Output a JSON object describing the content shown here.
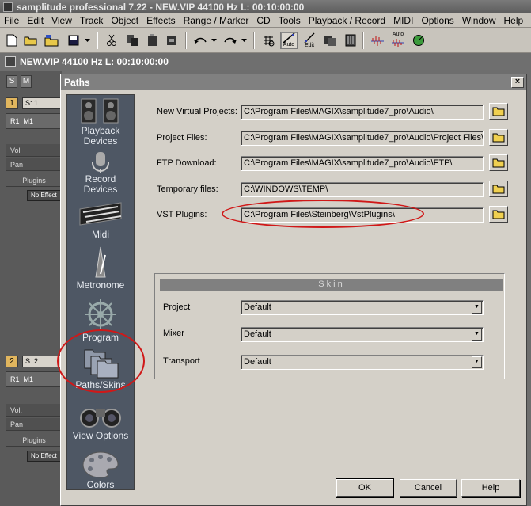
{
  "app": {
    "title": "samplitude professional 7.22 - NEW.VIP   44100 Hz L: 00:10:00:00"
  },
  "menu": [
    "File",
    "Edit",
    "View",
    "Track",
    "Object",
    "Effects",
    "Range / Marker",
    "CD",
    "Tools",
    "Playback / Record",
    "MIDI",
    "Options",
    "Window",
    "Help"
  ],
  "toolbar": {
    "auto_caption": "Auto",
    "edit_caption": "Edit",
    "auto2_caption": "Auto"
  },
  "document": {
    "title": "NEW.VIP   44100 Hz L: 00:10:00:00"
  },
  "tracks": {
    "s_label": "S",
    "m_label": "M",
    "items": [
      {
        "number": "1",
        "name": "S: 1",
        "r_label": "R1",
        "m_label": "M1",
        "vol": "Vol",
        "pan": "Pan",
        "plugins": "Plugins",
        "fx": "No Effect"
      },
      {
        "number": "2",
        "name": "S: 2",
        "r_label": "R1",
        "m_label": "M1",
        "vol": "Vol.",
        "pan": "Pan",
        "plugins": "Plugins",
        "fx": "No Effect"
      }
    ]
  },
  "dialog": {
    "title": "Paths",
    "close_glyph": "×",
    "sidebar": [
      {
        "icon": "playback-devices-icon",
        "label": "Playback\nDevices"
      },
      {
        "icon": "record-devices-icon",
        "label": "Record\nDevices"
      },
      {
        "icon": "midi-keyboard-icon",
        "label": "Midi"
      },
      {
        "icon": "metronome-icon",
        "label": "Metronome"
      },
      {
        "icon": "program-wheel-icon",
        "label": "Program"
      },
      {
        "icon": "folders-icon",
        "label": "Paths/Skins"
      },
      {
        "icon": "binoculars-icon",
        "label": "View Options"
      },
      {
        "icon": "palette-icon",
        "label": "Colors"
      }
    ],
    "paths": [
      {
        "label": "New Virtual Projects:",
        "value": "C:\\Program Files\\MAGIX\\samplitude7_pro\\Audio\\"
      },
      {
        "label": "Project Files:",
        "value": "C:\\Program Files\\MAGIX\\samplitude7_pro\\Audio\\Project Files\\"
      },
      {
        "label": "FTP Download:",
        "value": "C:\\Program Files\\MAGIX\\samplitude7_pro\\Audio\\FTP\\"
      },
      {
        "label": "Temporary files:",
        "value": "C:\\WINDOWS\\TEMP\\"
      },
      {
        "label": "VST Plugins:",
        "value": "C:\\Program Files\\Steinberg\\VstPlugins\\"
      }
    ],
    "skin": {
      "header": "Skin",
      "rows": [
        {
          "label": "Project",
          "value": "Default"
        },
        {
          "label": "Mixer",
          "value": "Default"
        },
        {
          "label": "Transport",
          "value": "Default"
        }
      ]
    },
    "buttons": {
      "ok": "OK",
      "cancel": "Cancel",
      "help": "Help"
    }
  },
  "colors": {
    "sidebar_bg": "#4e5764",
    "dialog_bg": "#d4d0c8",
    "annotation": "#d01818"
  }
}
